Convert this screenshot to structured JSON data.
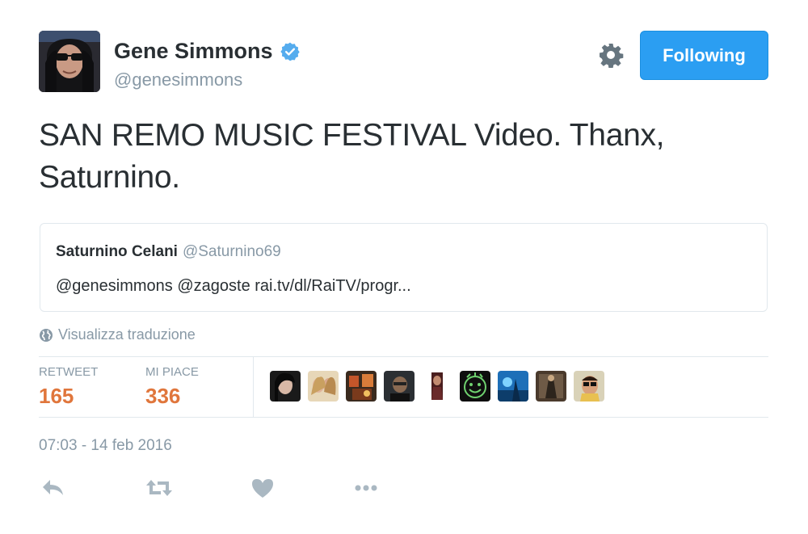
{
  "author": {
    "display_name": "Gene Simmons",
    "screen_name": "@genesimmons",
    "verified": true
  },
  "follow_button": {
    "label": "Following",
    "color": "#2b9ef2"
  },
  "tweet": {
    "text": "SAN REMO MUSIC FESTIVAL Video. Thanx, Saturnino."
  },
  "quoted_tweet": {
    "name": "Saturnino Celani",
    "handle": "@Saturnino69",
    "text": "@genesimmons @zagoste rai.tv/dl/RaiTV/progr..."
  },
  "translate_link": {
    "label": "Visualizza traduzione",
    "icon": "globe-icon"
  },
  "stats": {
    "retweets": {
      "label": "RETWEET",
      "value": "165"
    },
    "likes": {
      "label": "MI PIACE",
      "value": "336"
    },
    "accent_color": "#e0763c"
  },
  "likers_count_shown": 9,
  "timestamp": "07:03 - 14 feb 2016",
  "actions": [
    "reply-icon",
    "retweet-icon",
    "heart-icon",
    "more-icon"
  ]
}
